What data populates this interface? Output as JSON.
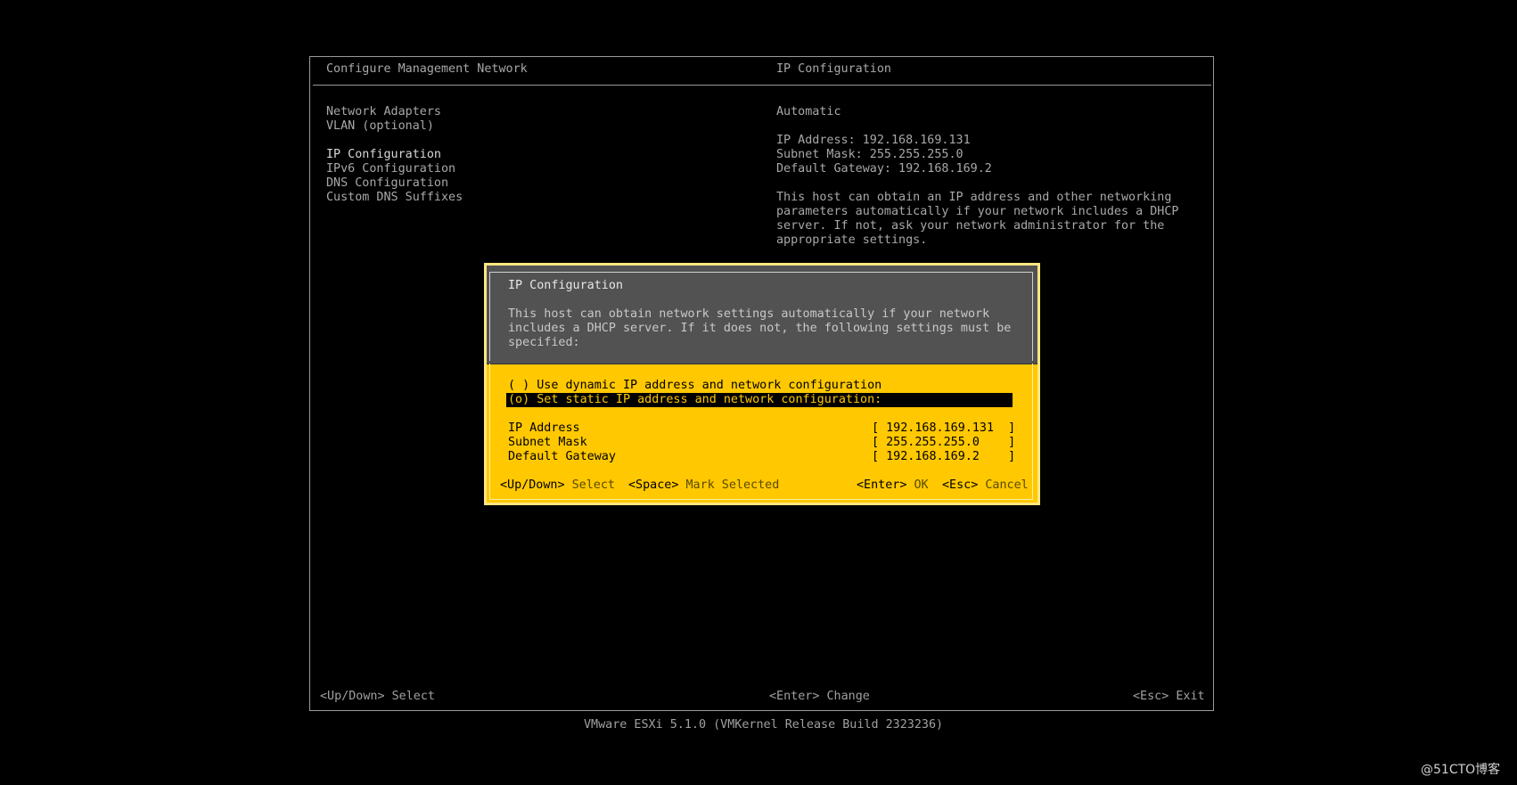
{
  "header": {
    "left_title": "Configure Management Network",
    "right_title": "IP Configuration"
  },
  "menu": [
    "Network Adapters",
    "VLAN (optional)",
    "IP Configuration",
    "IPv6 Configuration",
    "DNS Configuration",
    "Custom DNS Suffixes"
  ],
  "info": {
    "mode": "Automatic",
    "ip_line": "IP Address: 192.168.169.131",
    "subnet_line": "Subnet Mask: 255.255.255.0",
    "gateway_line": "Default Gateway: 192.168.169.2",
    "desc": [
      "This host can obtain an IP address and other networking",
      "parameters automatically if your network includes a DHCP",
      "server. If not, ask your network administrator for the",
      "appropriate settings."
    ]
  },
  "dialog": {
    "title": "IP Configuration",
    "desc": [
      "This host can obtain network settings automatically if your network",
      "includes a DHCP server. If it does not, the following settings must be",
      "specified:"
    ],
    "option_dynamic": "( ) Use dynamic IP address and network configuration",
    "option_static": "(o) Set static IP address and network configuration:",
    "fields": [
      {
        "label": "IP Address",
        "value": "[ 192.168.169.131  ]"
      },
      {
        "label": "Subnet Mask",
        "value": "[ 255.255.255.0    ]"
      },
      {
        "label": "Default Gateway",
        "value": "[ 192.168.169.2    ]"
      }
    ],
    "footer": {
      "updown_key": "<Up/Down>",
      "updown_action": "Select",
      "space_key": "<Space>",
      "space_action": "Mark Selected",
      "enter_key": "<Enter>",
      "enter_action": "OK",
      "esc_key": "<Esc>",
      "esc_action": "Cancel"
    }
  },
  "footer": {
    "updown": "<Up/Down> Select",
    "enter": "<Enter> Change",
    "esc": "<Esc> Exit"
  },
  "version": "VMware ESXi 5.1.0 (VMKernel Release Build 2323236)",
  "watermark": "@51CTO博客"
}
